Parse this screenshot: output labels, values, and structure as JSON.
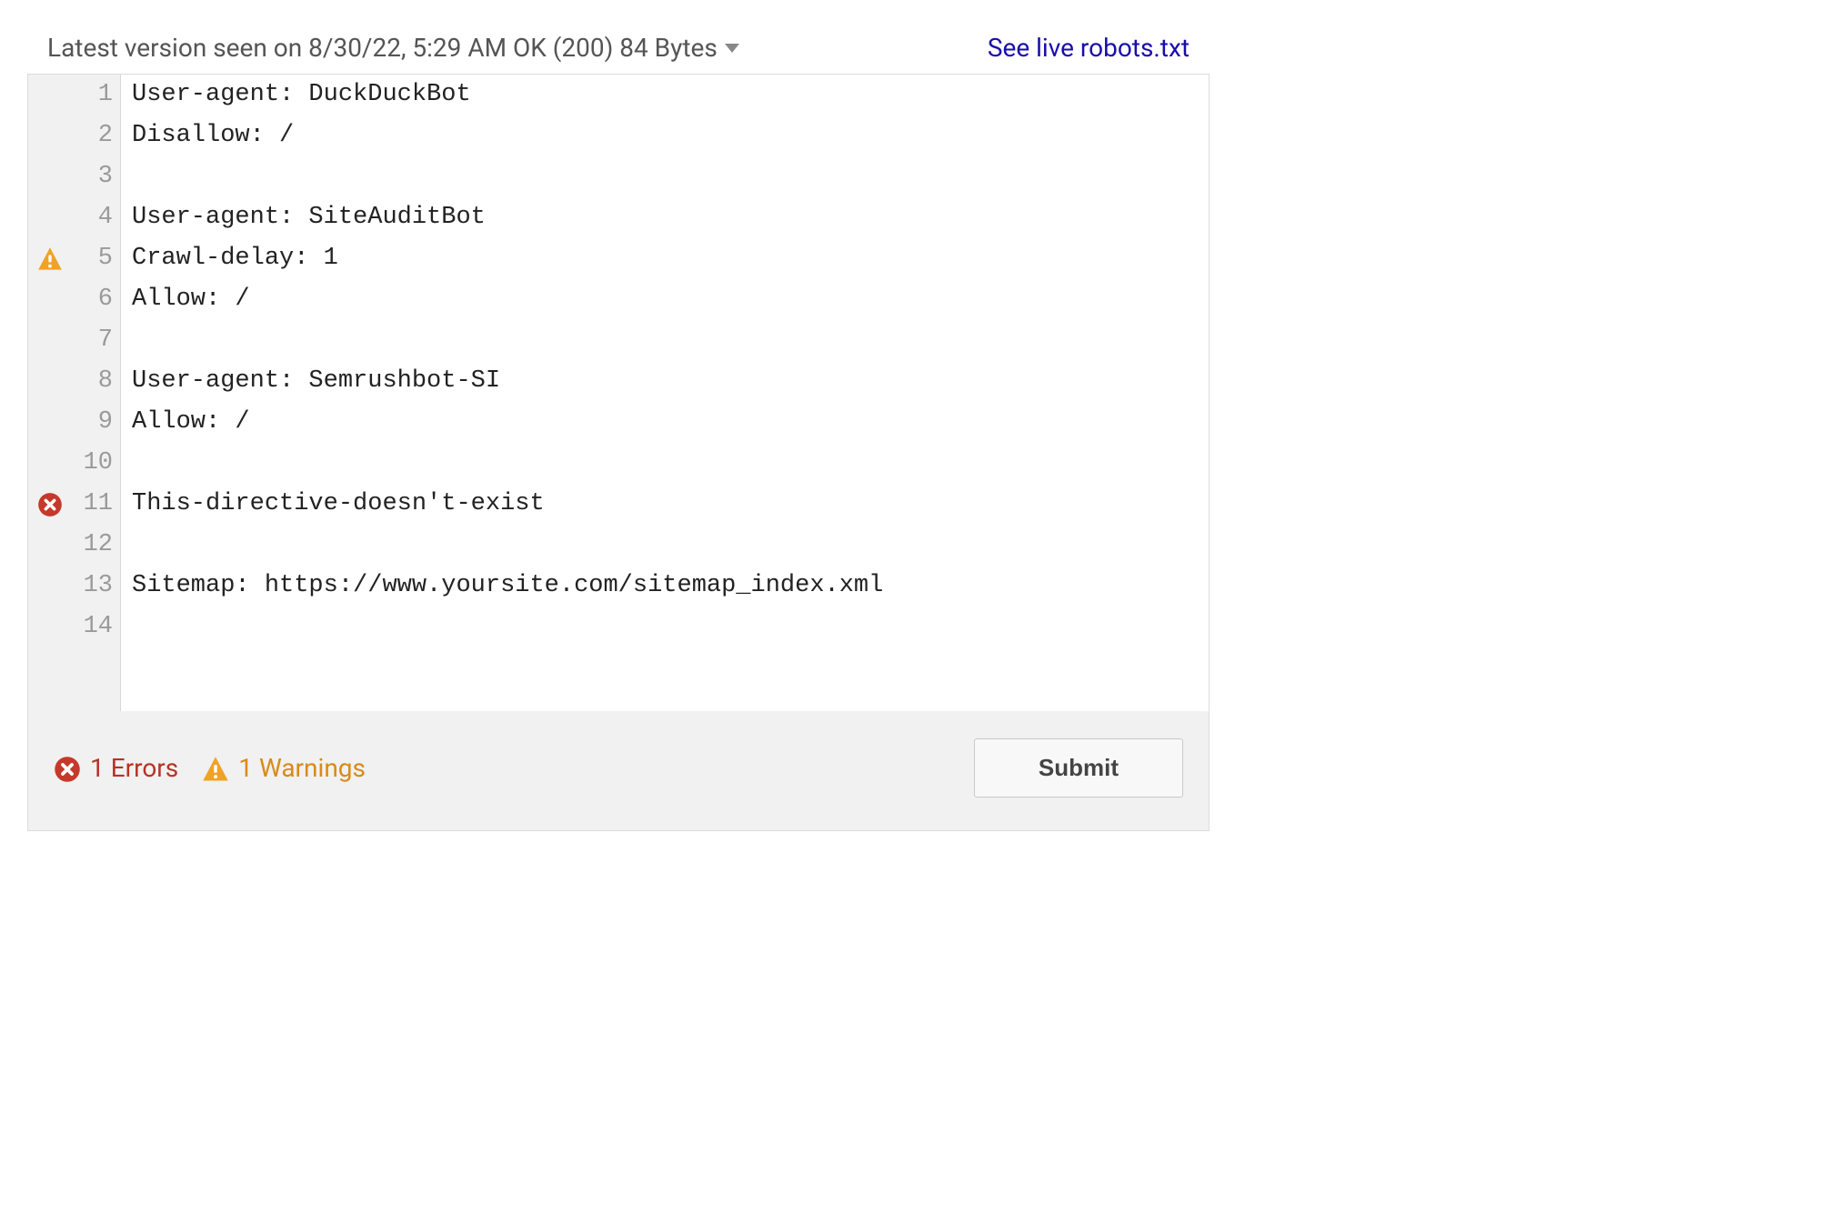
{
  "header": {
    "version_label": "Latest version seen on 8/30/22, 5:29 AM OK (200) 84 Bytes",
    "live_link_label": "See live robots.txt"
  },
  "editor": {
    "lines": [
      {
        "num": "1",
        "marker": "",
        "text": "User-agent: DuckDuckBot"
      },
      {
        "num": "2",
        "marker": "",
        "text": "Disallow: /"
      },
      {
        "num": "3",
        "marker": "",
        "text": ""
      },
      {
        "num": "4",
        "marker": "",
        "text": "User-agent: SiteAuditBot"
      },
      {
        "num": "5",
        "marker": "warning",
        "text": "Crawl-delay: 1"
      },
      {
        "num": "6",
        "marker": "",
        "text": "Allow: /"
      },
      {
        "num": "7",
        "marker": "",
        "text": ""
      },
      {
        "num": "8",
        "marker": "",
        "text": "User-agent: Semrushbot-SI"
      },
      {
        "num": "9",
        "marker": "",
        "text": "Allow: /"
      },
      {
        "num": "10",
        "marker": "",
        "text": ""
      },
      {
        "num": "11",
        "marker": "error",
        "text": "This-directive-doesn't-exist"
      },
      {
        "num": "12",
        "marker": "",
        "text": ""
      },
      {
        "num": "13",
        "marker": "",
        "text": "Sitemap: https://www.yoursite.com/sitemap_index.xml"
      },
      {
        "num": "14",
        "marker": "",
        "text": ""
      }
    ]
  },
  "footer": {
    "errors_count": "1",
    "errors_label": "Errors",
    "warnings_count": "1",
    "warnings_label": "Warnings",
    "submit_label": "Submit"
  }
}
